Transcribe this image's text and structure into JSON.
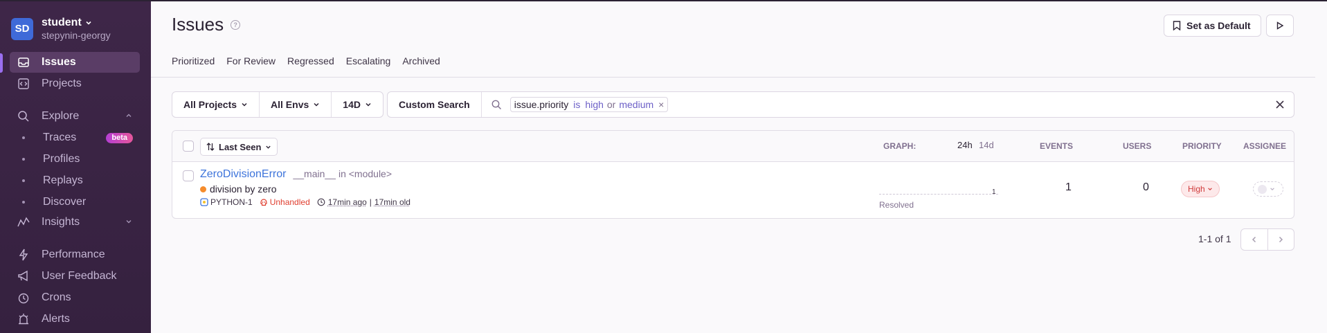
{
  "org": {
    "initials": "SD",
    "name": "student",
    "user": "stepynin-georgy"
  },
  "nav": {
    "issues": "Issues",
    "projects": "Projects",
    "explore": "Explore",
    "traces": "Traces",
    "traces_badge": "beta",
    "profiles": "Profiles",
    "replays": "Replays",
    "discover": "Discover",
    "insights": "Insights",
    "performance": "Performance",
    "user_feedback": "User Feedback",
    "crons": "Crons",
    "alerts": "Alerts"
  },
  "header": {
    "title": "Issues",
    "help_icon": "?",
    "set_default_label": "Set as Default",
    "tabs": [
      "Prioritized",
      "For Review",
      "Regressed",
      "Escalating",
      "Archived"
    ]
  },
  "filters": {
    "projects": "All Projects",
    "envs": "All Envs",
    "period": "14D"
  },
  "search": {
    "custom_search_label": "Custom Search",
    "token_key": "issue.priority",
    "token_op": "is",
    "token_val1": "high",
    "token_or": "or",
    "token_val2": "medium",
    "token_remove": "×"
  },
  "table": {
    "sort_label": "Last Seen",
    "col_graph": "GRAPH:",
    "col_24h": "24h",
    "col_14d": "14d",
    "col_events": "EVENTS",
    "col_users": "USERS",
    "col_priority": "PRIORITY",
    "col_assignee": "ASSIGNEE",
    "rows": [
      {
        "title": "ZeroDivisionError",
        "location": "__main__",
        "location_in": "in <module>",
        "message": "division by zero",
        "short_id": "PYTHON-1",
        "handled": "Unhandled",
        "last_seen": "17min ago",
        "first_seen": "17min old",
        "graph_count": "1",
        "status": "Resolved",
        "events": "1",
        "users": "0",
        "priority": "High"
      }
    ]
  },
  "pagination": {
    "text": "1-1 of 1"
  },
  "colors": {
    "accent": "#6c5fc7",
    "link": "#3d74db",
    "sidebar": "#3e2648",
    "priority_high": "#d03b3b"
  }
}
